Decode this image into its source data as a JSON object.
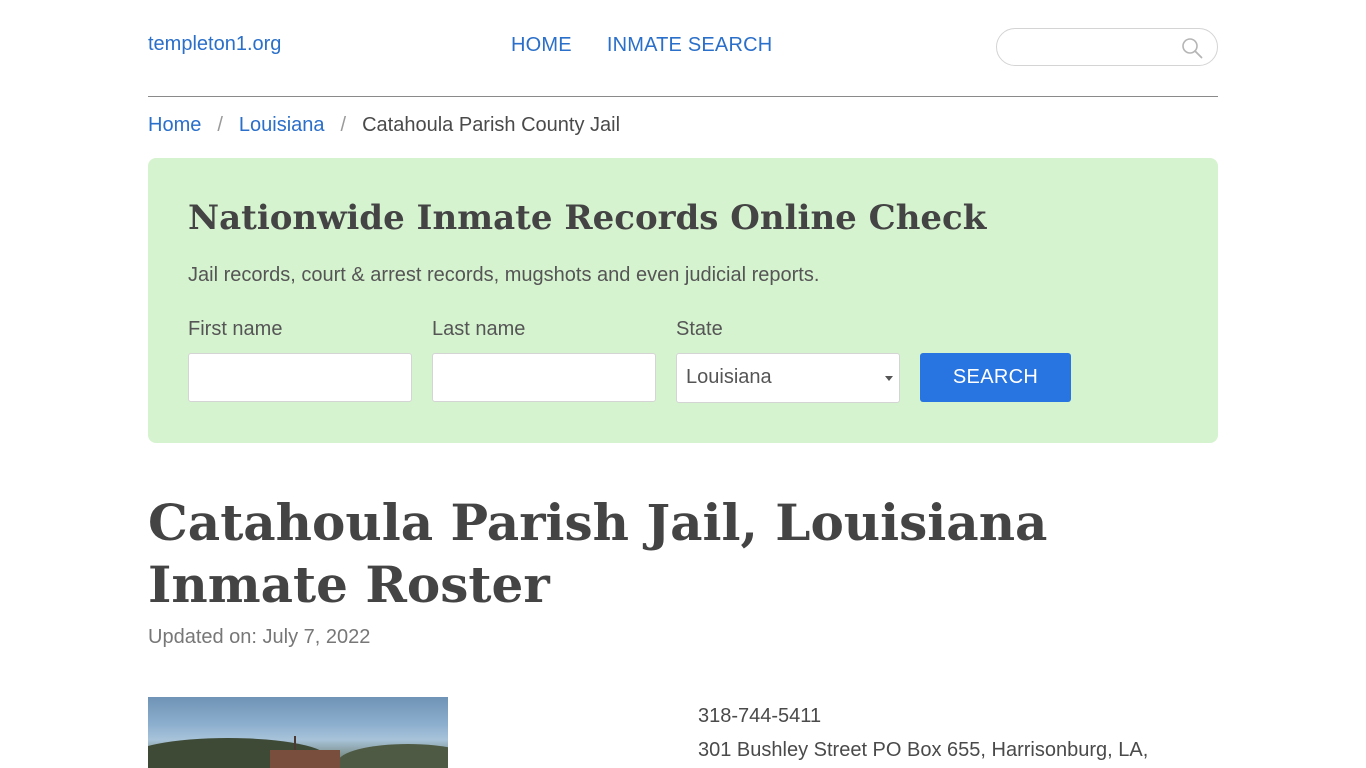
{
  "header": {
    "site_name": "templeton1.org",
    "nav": [
      {
        "label": "HOME"
      },
      {
        "label": "INMATE SEARCH"
      }
    ],
    "search": {
      "placeholder": "",
      "icon": "search-icon"
    }
  },
  "breadcrumb": {
    "items": [
      {
        "label": "Home"
      },
      {
        "label": "Louisiana"
      }
    ],
    "separator": "/",
    "current": "Catahoula Parish County Jail"
  },
  "panel": {
    "title": "Nationwide Inmate Records Online Check",
    "subtitle": "Jail records, court & arrest records, mugshots and even judicial reports.",
    "first_name_label": "First name",
    "last_name_label": "Last name",
    "state_label": "State",
    "state_value": "Louisiana",
    "search_button": "SEARCH",
    "background_color": "#d6f3d0",
    "button_color": "#2874e0"
  },
  "main": {
    "title": "Catahoula Parish Jail, Louisiana Inmate Roster",
    "updated": "Updated on: July 7, 2022",
    "phone": "318-744-5411",
    "address": "301 Bushley Street PO Box 655, Harrisonburg, LA,"
  },
  "colors": {
    "link": "#2a6fc9",
    "text": "#4a4a4a"
  }
}
